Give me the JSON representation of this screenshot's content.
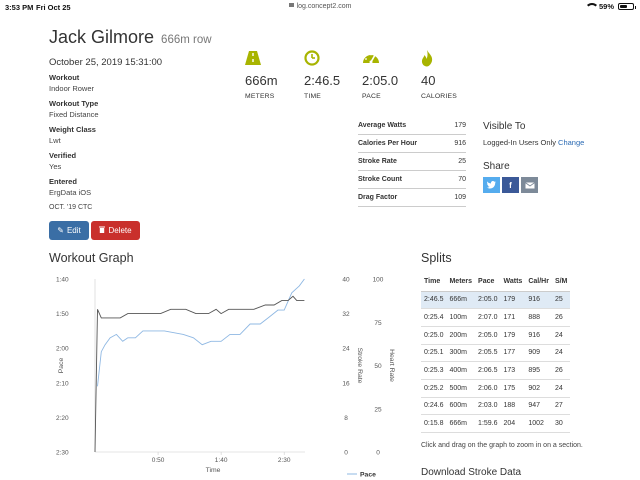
{
  "status_bar": {
    "time": "3:53 PM",
    "date": "Fri Oct 25",
    "url": "log.concept2.com",
    "battery": "59%",
    "battery_level": 0.59
  },
  "header": {
    "name": "Jack Gilmore",
    "distance": "666m row",
    "date": "October 25, 2019 15:31:00"
  },
  "meta": [
    {
      "label": "Workout",
      "value": "Indoor Rower"
    },
    {
      "label": "Workout Type",
      "value": "Fixed Distance"
    },
    {
      "label": "Weight Class",
      "value": "Lwt"
    },
    {
      "label": "Verified",
      "value": "Yes"
    },
    {
      "label": "Entered",
      "value": "ErgData iOS"
    }
  ],
  "challenge": "OCT. '19 CTC",
  "buttons": {
    "edit": "Edit",
    "delete": "Delete"
  },
  "stats": [
    {
      "icon": "road-icon",
      "value": "666m",
      "label": "METERS"
    },
    {
      "icon": "clock-icon",
      "value": "2:46.5",
      "label": "TIME"
    },
    {
      "icon": "speedometer-icon",
      "value": "2:05.0",
      "label": "PACE"
    },
    {
      "icon": "flame-icon",
      "value": "40",
      "label": "CALORIES"
    }
  ],
  "details": [
    {
      "label": "Average Watts",
      "value": "179"
    },
    {
      "label": "Calories Per Hour",
      "value": "916"
    },
    {
      "label": "Stroke Rate",
      "value": "25"
    },
    {
      "label": "Stroke Count",
      "value": "70"
    },
    {
      "label": "Drag Factor",
      "value": "109"
    }
  ],
  "visibility": {
    "heading": "Visible To",
    "value": "Logged-In Users Only",
    "change": "Change"
  },
  "share": {
    "heading": "Share",
    "icons": [
      "twitter-icon",
      "facebook-icon",
      "email-icon"
    ]
  },
  "workout_graph": {
    "heading": "Workout Graph",
    "chart_data": {
      "type": "line",
      "xlabel": "Time",
      "x_ticks": [
        "0:50",
        "1:40",
        "2:30"
      ],
      "x_tick_values": [
        50,
        100,
        150
      ],
      "x_range": [
        0,
        166.5
      ],
      "left_axis": {
        "label": "Pace",
        "ticks": [
          "1:40",
          "1:50",
          "2:00",
          "2:10",
          "2:20",
          "2:30"
        ],
        "range_seconds": [
          100,
          150
        ]
      },
      "right_axis_1": {
        "label": "Stroke Rate",
        "ticks": [
          "40",
          "32",
          "24",
          "16",
          "8",
          "0"
        ],
        "range": [
          0,
          40
        ]
      },
      "right_axis_2": {
        "label": "Heart Rate",
        "ticks": [
          "100",
          "75",
          "50",
          "25",
          "0"
        ],
        "range": [
          0,
          100
        ]
      },
      "legend": "Pace",
      "series": [
        {
          "name": "Pace",
          "color": "#8fb8e3",
          "axis": "pace",
          "points": [
            [
              2,
              131
            ],
            [
              5,
              121
            ],
            [
              8,
              119
            ],
            [
              12,
              117
            ],
            [
              17,
              116
            ],
            [
              22,
              118
            ],
            [
              26,
              117
            ],
            [
              32,
              117
            ],
            [
              38,
              115
            ],
            [
              45,
              115
            ],
            [
              55,
              115
            ],
            [
              70,
              116
            ],
            [
              78,
              117
            ],
            [
              85,
              119
            ],
            [
              92,
              118
            ],
            [
              100,
              118
            ],
            [
              107,
              116
            ],
            [
              115,
              116
            ],
            [
              123,
              113
            ],
            [
              131,
              113
            ],
            [
              138,
              111
            ],
            [
              145,
              109
            ],
            [
              150,
              109
            ],
            [
              156,
              104
            ],
            [
              162,
              102
            ],
            [
              166,
              100
            ]
          ]
        },
        {
          "color": "#555555",
          "axis": "stroke_rate",
          "points": [
            [
              0,
              0
            ],
            [
              2,
              33
            ],
            [
              5,
              31
            ],
            [
              9,
              31
            ],
            [
              13,
              31
            ],
            [
              20,
              31
            ],
            [
              26,
              32
            ],
            [
              38,
              32
            ],
            [
              52,
              32
            ],
            [
              60,
              33
            ],
            [
              72,
              33
            ],
            [
              80,
              32
            ],
            [
              90,
              32
            ],
            [
              96,
              33
            ],
            [
              100,
              32
            ],
            [
              106,
              33
            ],
            [
              118,
              33
            ],
            [
              126,
              33
            ],
            [
              135,
              34
            ],
            [
              142,
              34
            ],
            [
              148,
              35
            ],
            [
              153,
              35
            ],
            [
              157,
              36
            ],
            [
              160,
              35
            ],
            [
              166,
              35
            ]
          ]
        }
      ]
    }
  },
  "splits": {
    "heading": "Splits",
    "columns": [
      "Time",
      "Meters",
      "Pace",
      "Watts",
      "Cal/Hr",
      "S/M"
    ],
    "rows": [
      [
        "2:46.5",
        "666m",
        "2:05.0",
        "179",
        "916",
        "25"
      ],
      [
        "0:25.4",
        "100m",
        "2:07.0",
        "171",
        "888",
        "26"
      ],
      [
        "0:25.0",
        "200m",
        "2:05.0",
        "179",
        "916",
        "24"
      ],
      [
        "0:25.1",
        "300m",
        "2:05.5",
        "177",
        "909",
        "24"
      ],
      [
        "0:25.3",
        "400m",
        "2:06.5",
        "173",
        "895",
        "26"
      ],
      [
        "0:25.2",
        "500m",
        "2:06.0",
        "175",
        "902",
        "24"
      ],
      [
        "0:24.6",
        "600m",
        "2:03.0",
        "188",
        "947",
        "27"
      ],
      [
        "0:15.8",
        "666m",
        "1:59.6",
        "204",
        "1002",
        "30"
      ]
    ]
  },
  "hint": "Click and drag on the graph to zoom in on a section.",
  "download": "Download Stroke Data",
  "colors": {
    "accent": "#a8b400",
    "edit": "#3a6ea5",
    "delete": "#c9302c",
    "twitter": "#55acee",
    "facebook": "#3b5998",
    "email": "#7d8a99"
  }
}
